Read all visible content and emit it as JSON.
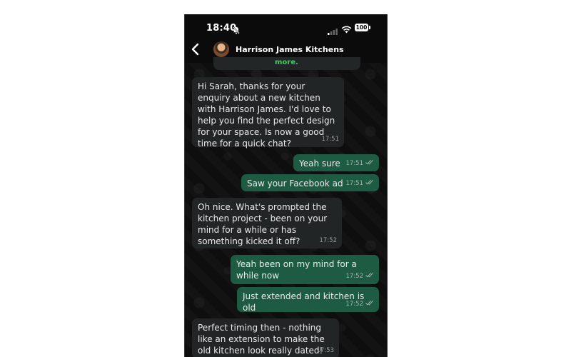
{
  "status_bar": {
    "time": "18:40",
    "battery": "100"
  },
  "header": {
    "contact_name": "Harrison James Kitchens"
  },
  "clipped_message": {
    "text": "more."
  },
  "messages": [
    {
      "direction": "in",
      "text": "Hi Sarah, thanks for your enquiry about a new kitchen with Harrison James. I'd love to help you find the perfect design for your space. Is now a good time for a quick chat?",
      "time": "17:51"
    },
    {
      "direction": "out",
      "text": "Yeah sure",
      "time": "17:51",
      "read": true
    },
    {
      "direction": "out",
      "text": "Saw your Facebook ad",
      "time": "17:51",
      "read": true
    },
    {
      "direction": "in",
      "text": "Oh nice. What's prompted the kitchen project - been on your mind for a while or has something kicked it off?",
      "time": "17:52"
    },
    {
      "direction": "out",
      "text": "Yeah been on my mind for a while now",
      "time": "17:52",
      "read": true
    },
    {
      "direction": "out",
      "text": "Just extended and kitchen is old",
      "time": "17:52",
      "read": true
    },
    {
      "direction": "in",
      "text": "Perfect timing then - nothing like an extension to make the old kitchen look really dated!",
      "time": "17:53"
    }
  ],
  "colors": {
    "outgoing_bubble": "#1d5c42",
    "incoming_bubble": "#222525",
    "link_green": "#3ecf5e"
  }
}
